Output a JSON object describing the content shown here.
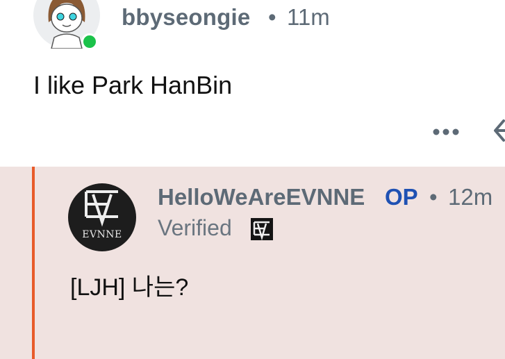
{
  "comment": {
    "username": "bbyseongie",
    "separator": "•",
    "time": "11m",
    "body": "I like Park HanBin",
    "online_color": "#1bc24a",
    "more_icon": "more-horizontal-icon",
    "reply_icon": "reply-arrow-icon"
  },
  "reply": {
    "username": "HelloWeAreEVNNE",
    "op_label": "OP",
    "separator": "•",
    "time": "12m",
    "verified_label": "Verified",
    "avatar_text": "EVNNE",
    "body": "[LJH] 나는?",
    "thread_line_color": "#e85b2a",
    "background": "#f0e2e0",
    "op_color": "#1f51b3"
  }
}
